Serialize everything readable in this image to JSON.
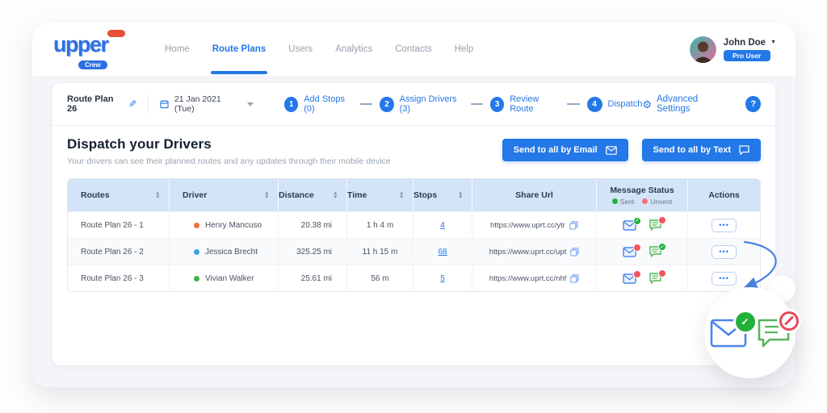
{
  "brand": {
    "name": "upper",
    "sub": "Crew"
  },
  "nav": {
    "items": [
      {
        "label": "Home"
      },
      {
        "label": "Route Plans",
        "active": true
      },
      {
        "label": "Users"
      },
      {
        "label": "Analytics"
      },
      {
        "label": "Contacts"
      },
      {
        "label": "Help"
      }
    ]
  },
  "user": {
    "name": "John Doe",
    "badge": "Pro User"
  },
  "planbar": {
    "plan_name": "Route Plan 26",
    "date": "21 Jan 2021 (Tue)",
    "steps": [
      {
        "num": "1",
        "label": "Add Stops (0)"
      },
      {
        "num": "2",
        "label": "Assign Drivers (3)"
      },
      {
        "num": "3",
        "label": "Review Route"
      },
      {
        "num": "4",
        "label": "Dispatch"
      }
    ],
    "advanced": "Advanced Settings",
    "help": "?"
  },
  "dispatch": {
    "title": "Dispatch your Drivers",
    "subtitle": "Your drivers can see their planned routes and any updates through their mobile device",
    "email_button": "Send to all by Email",
    "text_button": "Send to all by Text"
  },
  "table": {
    "headers": [
      {
        "label": "Routes",
        "sortable": true
      },
      {
        "label": "Driver",
        "sortable": true
      },
      {
        "label": "Distance",
        "sortable": true
      },
      {
        "label": "Time",
        "sortable": true
      },
      {
        "label": "Stops",
        "sortable": true
      },
      {
        "label": "Share Url",
        "sortable": false
      },
      {
        "label": "Message Status",
        "sortable": false
      },
      {
        "label": "Actions",
        "sortable": false
      }
    ],
    "legend": {
      "sent": "Sent",
      "unsent": "Unsent"
    },
    "rows": [
      {
        "route": "Route Plan 26 - 1",
        "driver": "Henry Mancuso",
        "driver_color": "#f4703b",
        "distance": "20.38 mi",
        "time": "1 h 4 m",
        "stops": "4",
        "url": "https://www.uprt.cc/ytr",
        "email_status": "sent",
        "text_status": "unsent"
      },
      {
        "route": "Route Plan 26 - 2",
        "driver": "Jessica Brecht",
        "driver_color": "#38a1e6",
        "distance": "325.25 mi",
        "time": "11 h 15 m",
        "stops": "68",
        "url": "https://www.uprt.cc/upt",
        "email_status": "unsent",
        "text_status": "sent"
      },
      {
        "route": "Route Plan 26 - 3",
        "driver": "Vivian Walker",
        "driver_color": "#3cb54a",
        "distance": "25.61 mi",
        "time": "56 m",
        "stops": "5",
        "url": "https://www.uprt.cc/nhf",
        "email_status": "unsent",
        "text_status": "unsent"
      }
    ],
    "actions_icon": "•••"
  },
  "icons": {
    "dropdown": "▼",
    "edit": "✎",
    "gear": "⚙",
    "sort_up": "▴",
    "sort_down": "▾"
  },
  "colors": {
    "primary": "#2478e8",
    "sent_green": "#23b03a",
    "unsent_red": "#f2545f",
    "header_bg": "#d3e3f8"
  }
}
